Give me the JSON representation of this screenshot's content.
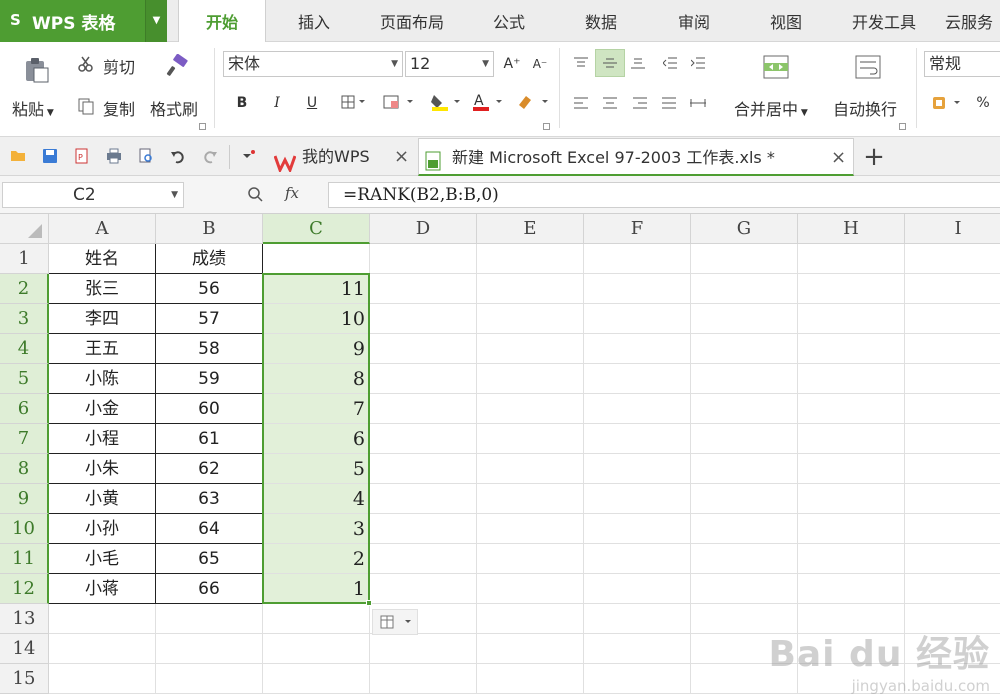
{
  "app": {
    "logo_mark": "S",
    "name": "WPS 表格"
  },
  "menu": {
    "tabs": [
      "开始",
      "插入",
      "页面布局",
      "公式",
      "数据",
      "审阅",
      "视图",
      "开发工具",
      "云服务"
    ]
  },
  "ribbon": {
    "paste": "粘贴",
    "cut": "剪切",
    "copy": "复制",
    "format_painter": "格式刷",
    "font_name": "宋体",
    "font_size": "12",
    "grow": "A⁺",
    "shrink": "A⁻",
    "bold": "B",
    "italic": "I",
    "underline": "U",
    "merge_center": "合并居中",
    "wrap_text": "自动换行",
    "number_format": "常规",
    "percent": "%",
    "accent": "#4e9d32",
    "font_color": "#e02020",
    "fill_color": "#ffe600"
  },
  "doc_tabs": [
    {
      "label": "我的WPS",
      "close": "×"
    },
    {
      "label": "新建 Microsoft Excel 97-2003 工作表.xls *",
      "close": "×"
    }
  ],
  "new_tab": "+",
  "formula_bar": {
    "name_box": "C2",
    "fx": "fx",
    "formula": "=RANK(B2,B:B,0)"
  },
  "sheet": {
    "columns": [
      "A",
      "B",
      "C",
      "D",
      "E",
      "F",
      "G",
      "H",
      "I"
    ],
    "rows": [
      "1",
      "2",
      "3",
      "4",
      "5",
      "6",
      "7",
      "8",
      "9",
      "10",
      "11",
      "12",
      "13",
      "14",
      "15"
    ],
    "header": [
      "姓名",
      "成绩"
    ],
    "data": [
      {
        "name": "张三",
        "score": "56",
        "rank": "11"
      },
      {
        "name": "李四",
        "score": "57",
        "rank": "10"
      },
      {
        "name": "王五",
        "score": "58",
        "rank": "9"
      },
      {
        "name": "小陈",
        "score": "59",
        "rank": "8"
      },
      {
        "name": "小金",
        "score": "60",
        "rank": "7"
      },
      {
        "name": "小程",
        "score": "61",
        "rank": "6"
      },
      {
        "name": "小朱",
        "score": "62",
        "rank": "5"
      },
      {
        "name": "小黄",
        "score": "63",
        "rank": "4"
      },
      {
        "name": "小孙",
        "score": "64",
        "rank": "3"
      },
      {
        "name": "小毛",
        "score": "65",
        "rank": "2"
      },
      {
        "name": "小蒋",
        "score": "66",
        "rank": "1"
      }
    ],
    "selected_column": "C",
    "selected_rows": [
      "2",
      "3",
      "4",
      "5",
      "6",
      "7",
      "8",
      "9",
      "10",
      "11",
      "12"
    ]
  },
  "watermark": {
    "brand": "Bai du 经验",
    "url": "jingyan.baidu.com"
  }
}
